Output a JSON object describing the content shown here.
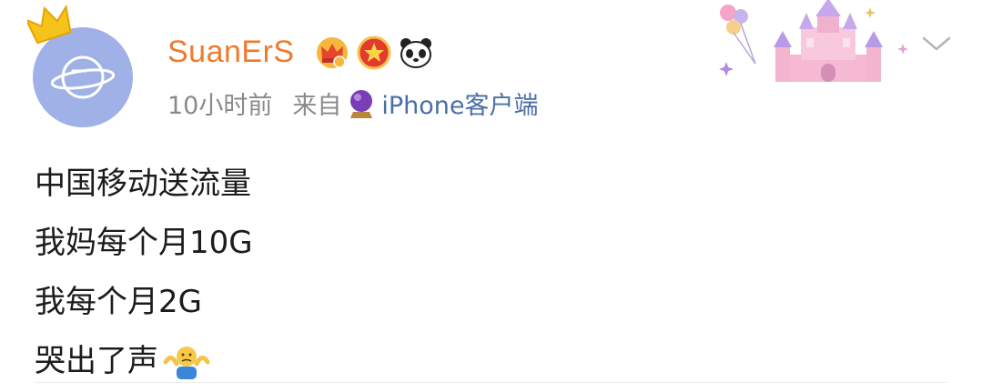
{
  "post": {
    "author": {
      "name": "SuanErS"
    },
    "meta": {
      "time": "10小时前",
      "via_prefix": "来自",
      "source": "iPhone客户端"
    },
    "badges": [
      "crown-vip-badge",
      "red-star-badge",
      "panda-badge"
    ],
    "content_lines": [
      "中国移动送流量",
      "我妈每个月10G",
      "我每个月2G",
      "哭出了声"
    ],
    "content_emoji": "shrug-emoji"
  },
  "colors": {
    "username": "#ee7a2e",
    "meta_text": "#8a8a8a",
    "source_text": "#4a6fa5",
    "avatar_bg": "#9fb1e6"
  }
}
